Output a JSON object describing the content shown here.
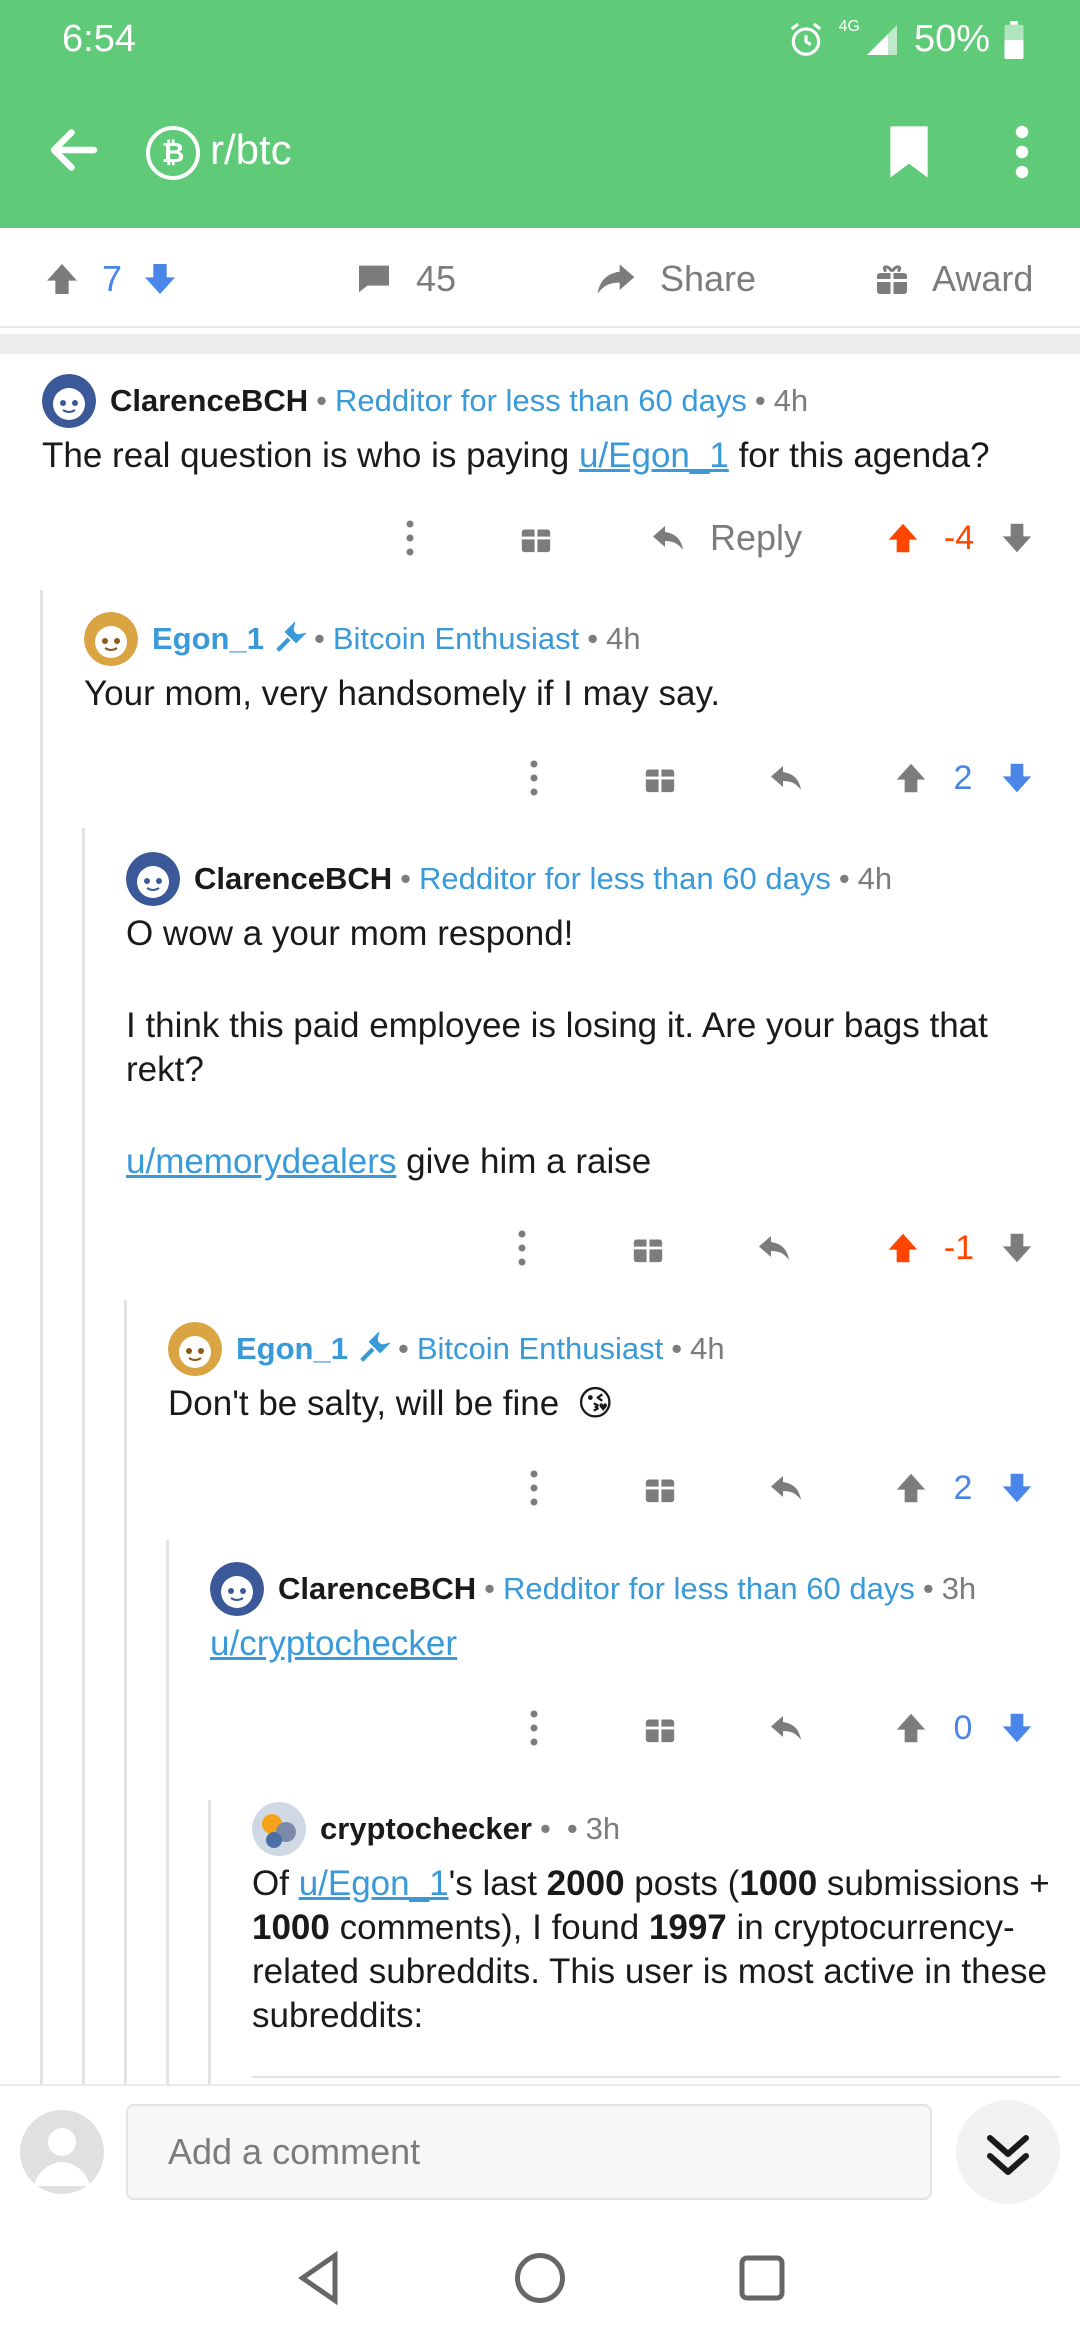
{
  "status_bar": {
    "time": "6:54",
    "network": "4G",
    "battery": "50%"
  },
  "header": {
    "subreddit": "r/btc",
    "sub_icon_glyph": "₿",
    "bg_color": "#5fca78"
  },
  "post_actions": {
    "votes": "7",
    "comments": "45",
    "share_label": "Share",
    "award_label": "Award"
  },
  "comments": [
    {
      "author": "ClarenceBCH",
      "flair": "Redditor for less than 60 days",
      "time": "4h",
      "body_pre": "The real question is who is paying ",
      "body_link": "u/Egon_1",
      "body_post": " for this agenda?",
      "reply_label": "Reply",
      "score": "-4",
      "vote_state": "up-orange"
    },
    {
      "author": "Egon_1",
      "flair": "Bitcoin Enthusiast",
      "time": "4h",
      "body": "Your mom, very handsomely if I may say.",
      "score": "2"
    },
    {
      "author": "ClarenceBCH",
      "flair": "Redditor for less than 60 days",
      "time": "4h",
      "body_line1": "O wow a your mom respond!",
      "body_line2": "I think this paid employee is losing it. Are your bags that rekt?",
      "body_link": "u/memorydealers",
      "body_post": " give him a raise",
      "score": "-1"
    },
    {
      "author": "Egon_1",
      "flair": "Bitcoin Enthusiast",
      "time": "4h",
      "body": "Don't be salty, will be fine",
      "emoji": "😘",
      "score": "2"
    },
    {
      "author": "ClarenceBCH",
      "flair": "Redditor for less than 60 days",
      "time": "3h",
      "body_link": "u/cryptochecker",
      "score": "0"
    },
    {
      "author": "cryptochecker",
      "time": "3h",
      "body_pre": "Of ",
      "body_link": "u/Egon_1",
      "body_a": "'s last ",
      "body_b": "2000",
      "body_c": " posts (",
      "body_d": "1000",
      "body_e": " submissions + ",
      "body_f": "1000",
      "body_g": " comments), I found ",
      "body_h": "1997",
      "body_i": " in cryptocurrency-related subreddits. This user is most active in these subreddits:"
    }
  ],
  "composer": {
    "placeholder": "Add a comment"
  },
  "colors": {
    "upvote_active": "#ff4500",
    "downvote_blue": "#4a86e8",
    "score_blue": "#4a86e8",
    "flair_blue": "#3a9ad9",
    "grey": "#7c7c7c"
  }
}
